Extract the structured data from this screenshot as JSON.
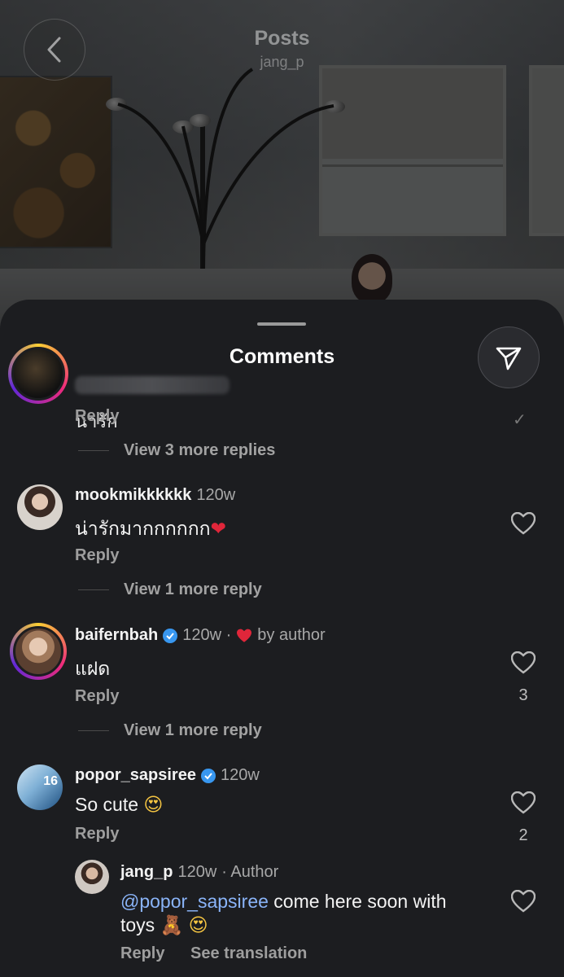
{
  "header": {
    "title": "Posts",
    "username": "jang_p"
  },
  "sheet": {
    "title": "Comments"
  },
  "comments": [
    {
      "username": "",
      "text": "น่ารัก",
      "reply_label": "Reply",
      "view_more": "View 3 more replies"
    },
    {
      "username": "mookmikkkkkk",
      "time": "120w",
      "text": "น่ารักมากกกกกก",
      "emoji": "❤️",
      "reply_label": "Reply",
      "view_more": "View 1 more reply"
    },
    {
      "username": "baifernbah",
      "verified": true,
      "time": "120w ·",
      "author_like": "by author",
      "text": "แฝด",
      "reply_label": "Reply",
      "likes": "3",
      "view_more": "View 1 more reply"
    },
    {
      "username": "popor_sapsiree",
      "verified": true,
      "time": "120w",
      "text": "So cute",
      "emoji": "😍",
      "reply_label": "Reply",
      "likes": "2"
    }
  ],
  "reply": {
    "username": "jang_p",
    "time": "120w",
    "badge": "· Author",
    "mention": "@popor_sapsiree",
    "text": "come here soon with",
    "text2": "toys",
    "emoji1": "🧸",
    "emoji2": "😍",
    "reply_label": "Reply",
    "translate_label": "See translation"
  },
  "colors": {
    "sheet_bg": "#1c1d20",
    "verified": "#3897f0",
    "mention": "#8ab4f8",
    "heart_red": "#e0263a"
  }
}
